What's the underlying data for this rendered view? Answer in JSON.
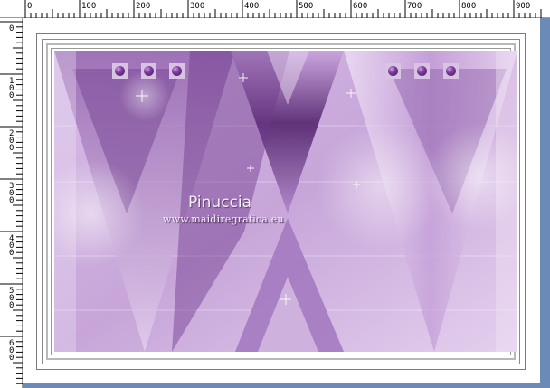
{
  "ruler": {
    "top_labels": [
      "0",
      "100",
      "200",
      "300",
      "400",
      "500",
      "600",
      "700",
      "800",
      "900"
    ],
    "left_labels": [
      "0",
      "1 0 0",
      "2 0 0",
      "3 0 0",
      "4 0 0",
      "5 0 0",
      "6 0 0"
    ]
  },
  "artwork": {
    "signature_name": "Pinuccia",
    "signature_url": "www.maidiregrafica.eu",
    "gem_count": 6
  },
  "colors": {
    "canvas_background": "#6b8ab8",
    "artwork_light": "#efe1f5",
    "artwork_mid": "#b78fd0",
    "artwork_dark": "#5a2c74",
    "gem": "#6a2a8c"
  }
}
